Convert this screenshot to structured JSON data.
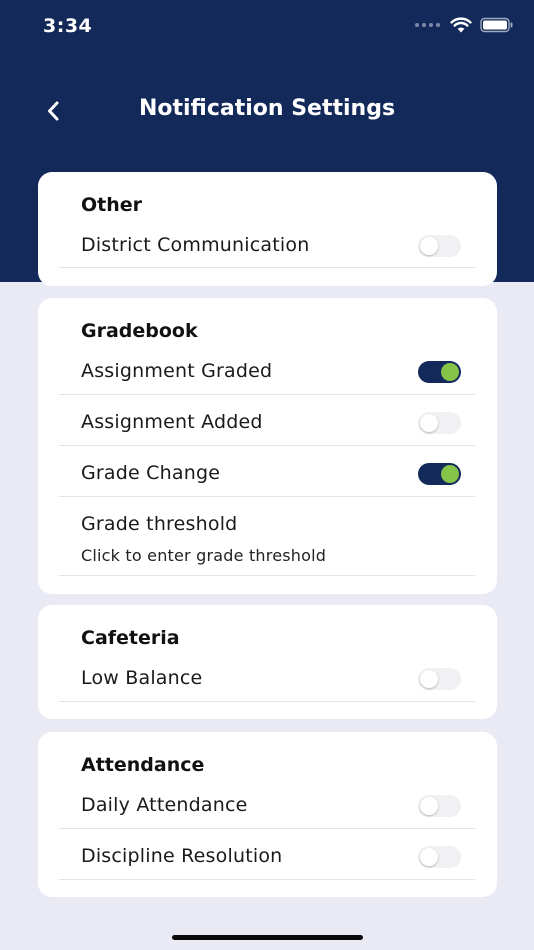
{
  "status_bar": {
    "time": "3:34"
  },
  "nav": {
    "title": "Notification Settings"
  },
  "colors": {
    "header": "#13295a",
    "toggle_on_track": "#13295a",
    "toggle_on_knob": "#86c449",
    "background": "#eaeaf5"
  },
  "sections": {
    "other": {
      "title": "Other",
      "items": [
        {
          "label": "District Communication",
          "enabled": false
        }
      ]
    },
    "gradebook": {
      "title": "Gradebook",
      "items": [
        {
          "label": "Assignment Graded",
          "enabled": true
        },
        {
          "label": "Assignment Added",
          "enabled": false
        },
        {
          "label": "Grade Change",
          "enabled": true
        }
      ],
      "threshold": {
        "label": "Grade threshold",
        "hint": "Click to enter grade threshold"
      }
    },
    "cafeteria": {
      "title": "Cafeteria",
      "items": [
        {
          "label": "Low Balance",
          "enabled": false
        }
      ]
    },
    "attendance": {
      "title": "Attendance",
      "items": [
        {
          "label": "Daily Attendance",
          "enabled": false
        },
        {
          "label": "Discipline Resolution",
          "enabled": false
        }
      ]
    }
  }
}
